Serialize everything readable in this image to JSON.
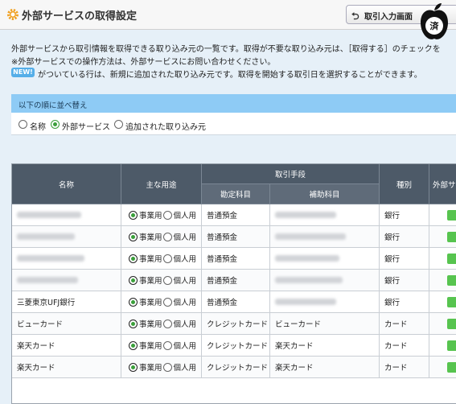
{
  "header": {
    "title": "外部サービスの取得設定",
    "back_button_label": "取引入力画面",
    "badge_text": "済"
  },
  "intro": {
    "line1": "外部サービスから取引情報を取得できる取り込み元の一覧です。取得が不要な取り込み元は、［取得する］のチェックを",
    "line2": "※外部サービスでの操作方法は、外部サービスにお問い合わせください。",
    "new_badge": "NEW!",
    "line3": "がついている行は、新規に追加された取り込み元です。取得を開始する取引日を選択することができます。"
  },
  "sort": {
    "heading": "以下の順に並べ替え",
    "options": [
      "名称",
      "外部サービス",
      "追加された取り込み元"
    ],
    "selected": "外部サービス"
  },
  "table": {
    "headers": {
      "name": "名称",
      "use": "主な用途",
      "method": "取引手段",
      "account": "勘定科目",
      "sub_account": "補助科目",
      "kind": "種別",
      "external": "外部サ"
    },
    "use_options": [
      "事業用",
      "個人用"
    ],
    "rows": [
      {
        "name": "",
        "account": "普通預金",
        "sub_account": "",
        "kind": "銀行",
        "use": "事業用"
      },
      {
        "name": "",
        "account": "普通預金",
        "sub_account": "",
        "kind": "銀行",
        "use": "事業用"
      },
      {
        "name": "",
        "account": "普通預金",
        "sub_account": "",
        "kind": "銀行",
        "use": "事業用"
      },
      {
        "name": "",
        "account": "普通預金",
        "sub_account": "",
        "kind": "銀行",
        "use": "事業用"
      },
      {
        "name": "三菱東京UFJ銀行",
        "account": "普通預金",
        "sub_account": "",
        "kind": "銀行",
        "use": "事業用"
      },
      {
        "name": "ビューカード",
        "account": "クレジットカード",
        "sub_account": "ビューカード",
        "kind": "カード",
        "use": "事業用"
      },
      {
        "name": "楽天カード",
        "account": "クレジットカード",
        "sub_account": "楽天カード",
        "kind": "カード",
        "use": "事業用"
      },
      {
        "name": "楽天カード",
        "account": "クレジットカード",
        "sub_account": "楽天カード",
        "kind": "カード",
        "use": "事業用"
      }
    ]
  },
  "colors": {
    "header_bg": "#4d5a68",
    "sort_header_bg": "#8ecbf5",
    "new_badge": "#55aee8",
    "radio_selected": "#3a9f3a",
    "external_icon": "#57c44f"
  }
}
